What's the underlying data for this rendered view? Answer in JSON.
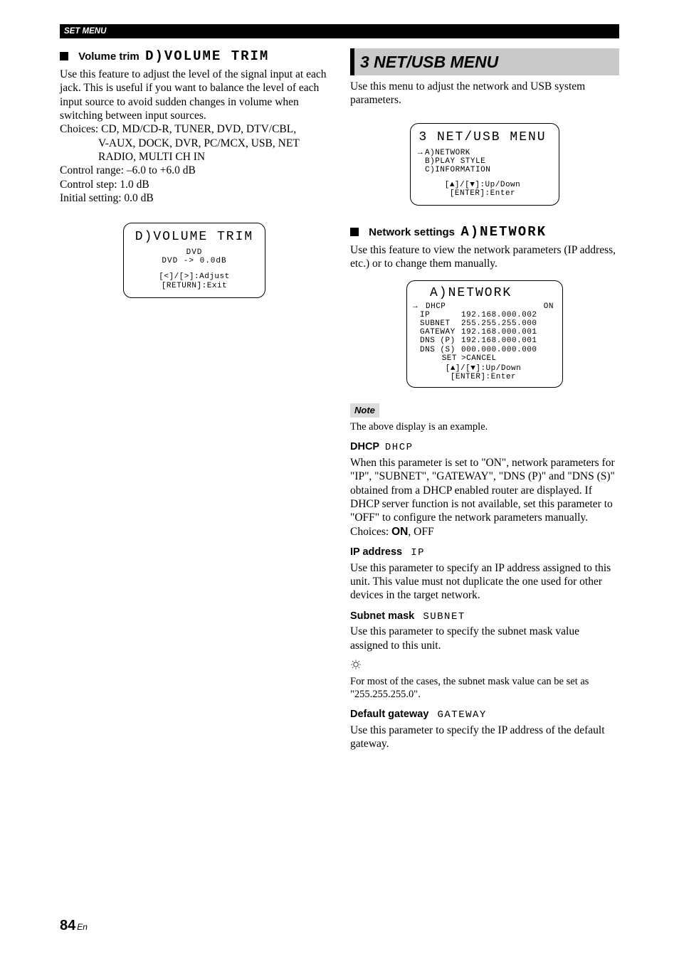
{
  "header": {
    "section": "SET MENU"
  },
  "left": {
    "heading": {
      "title": "Volume trim",
      "lcd": "D)VOLUME TRIM"
    },
    "intro": "Use this feature to adjust the level of the signal input at each jack. This is useful if you want to balance the level of each input source to avoid sudden changes in volume when switching between input sources.",
    "choices_label": "Choices:",
    "choices_line1": "CD, MD/CD-R, TUNER, DVD, DTV/CBL,",
    "choices_line2": "V-AUX, DOCK, DVR, PC/MCX, USB, NET RADIO, MULTI CH IN",
    "ctrl_range": "Control range: –6.0 to +6.0 dB",
    "ctrl_step": "Control step: 1.0 dB",
    "initial": "Initial setting: 0.0 dB",
    "panel1": {
      "title": "D)VOLUME TRIM",
      "line1": "DVD",
      "line2": "DVD ->   0.0dB",
      "hint1": "[<]/[>]:Adjust",
      "hint2": "[RETURN]:Exit"
    }
  },
  "right": {
    "section_title": "3 NET/USB MENU",
    "intro": "Use this menu to adjust the network and USB system parameters.",
    "panel2": {
      "title": "3 NET/USB MENU",
      "a": "A)NETWORK",
      "b": "B)PLAY STYLE",
      "c": "C)INFORMATION",
      "hint1": "[▲]/[▼]:Up/Down",
      "hint2": "[ENTER]:Enter"
    },
    "network_heading": {
      "title": "Network settings",
      "lcd": "A)NETWORK"
    },
    "network_intro": "Use this feature to view the network parameters (IP address, etc.) or to change them manually.",
    "panel3": {
      "title": "A)NETWORK",
      "rows": {
        "dhcp_k": "DHCP",
        "dhcp_v": "ON",
        "ip_k": "IP",
        "ip_v": "192.168.000.002",
        "subnet_k": "SUBNET",
        "subnet_v": "255.255.255.000",
        "gateway_k": "GATEWAY",
        "gateway_v": "192.168.000.001",
        "dnsp_k": "DNS (P)",
        "dnsp_v": "192.168.000.001",
        "dnss_k": "DNS (S)",
        "dnss_v": "000.000.000.000",
        "set_k": "SET",
        "set_v": ">CANCEL"
      },
      "hint1": "[▲]/[▼]:Up/Down",
      "hint2": "[ENTER]:Enter"
    },
    "note_label": "Note",
    "note_text": "The above display is an example.",
    "dhcp": {
      "title": "DHCP",
      "lcd": "DHCP",
      "body": "When this parameter is set to \"ON\", network parameters for \"IP\", \"SUBNET\", \"GATEWAY\", \"DNS (P)\" and \"DNS (S)\" obtained from a DHCP enabled router are displayed. If DHCP server function is not available, set this parameter to \"OFF\" to configure the network parameters manually.",
      "choices_label": "Choices: ",
      "choices_bold": "ON",
      "choices_rest": ", OFF"
    },
    "ip": {
      "title": "IP address",
      "lcd": "IP",
      "body": "Use this parameter to specify an IP address assigned to this unit. This value must not duplicate the one used for other devices in the target network."
    },
    "subnet": {
      "title": "Subnet mask",
      "lcd": "SUBNET",
      "body": "Use this parameter to specify the subnet mask value assigned to this unit."
    },
    "tip": "For most of the cases, the subnet mask value can be set as \"255.255.255.0\".",
    "gateway": {
      "title": "Default gateway",
      "lcd": "GATEWAY",
      "body": "Use this parameter to specify the IP address of the default gateway."
    }
  },
  "page": {
    "number": "84",
    "suffix": "En"
  }
}
